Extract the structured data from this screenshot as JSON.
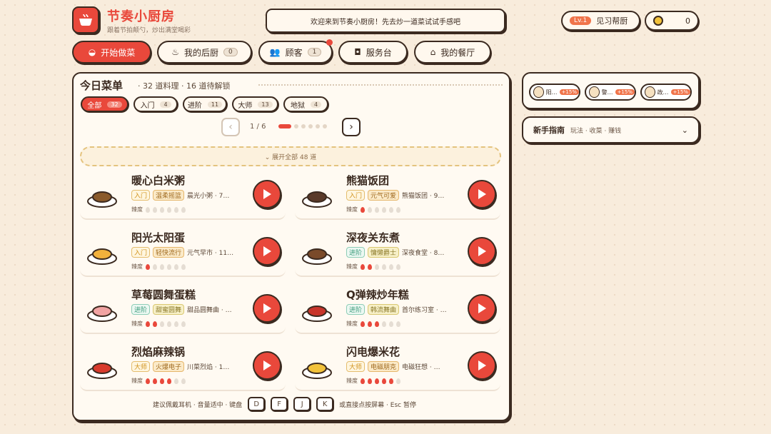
{
  "app": {
    "title": "节奏小厨房",
    "subtitle": "跟着节拍颠勺，炒出满堂喝彩",
    "welcome": "欢迎来到节奏小厨房！先去炒一道菜试试手感吧"
  },
  "player": {
    "level": "Lv.1",
    "rank": "见习帮厨",
    "coins": "0"
  },
  "nav": {
    "start": "开始做菜",
    "kitchen": "我的后厨",
    "kitchen_count": "0",
    "customers": "顾客",
    "customers_count": "1",
    "counter": "服务台",
    "restaurant": "我的餐厅"
  },
  "menu": {
    "title": "今日菜单",
    "summary": "· 32 道料理 · 16 道待解锁",
    "page": "1 / 6",
    "expand": "⌄ 展开全部 48 道",
    "filters": [
      {
        "label": "全部",
        "count": "32"
      },
      {
        "label": "入门",
        "count": "4"
      },
      {
        "label": "进阶",
        "count": "11"
      },
      {
        "label": "大师",
        "count": "13"
      },
      {
        "label": "地狱",
        "count": "4"
      }
    ],
    "spice_label": "辣度",
    "dishes": [
      {
        "name": "暖心白米粥",
        "level": "入门",
        "genre": "温柔摇篮",
        "song": "晨光小粥 · 7…",
        "spice": 0
      },
      {
        "name": "熊猫饭团",
        "level": "入门",
        "genre": "元气可爱",
        "song": "熊猫饭团 · 9…",
        "spice": 1
      },
      {
        "name": "阳光太阳蛋",
        "level": "入门",
        "genre": "轻快流行",
        "song": "元气早市 · 11…",
        "spice": 1
      },
      {
        "name": "深夜关东煮",
        "level": "进阶",
        "genre": "慵懒爵士",
        "song": "深夜食堂 · 8…",
        "spice": 2
      },
      {
        "name": "草莓圆舞蛋糕",
        "level": "进阶",
        "genre": "甜蜜圆舞",
        "song": "甜品圆舞曲 · …",
        "spice": 2
      },
      {
        "name": "Q弹辣炒年糕",
        "level": "进阶",
        "genre": "韩流舞曲",
        "song": "首尔练习室 · …",
        "spice": 3
      },
      {
        "name": "烈焰麻辣锅",
        "level": "大师",
        "genre": "火爆电子",
        "song": "川菜烈焰 · 1…",
        "spice": 4
      },
      {
        "name": "闪电爆米花",
        "level": "大师",
        "genre": "电磁朋克",
        "song": "电磁狂想 · …",
        "spice": 5
      }
    ]
  },
  "footer": {
    "hint": "建议佩戴耳机 · 音量适中 · 键盘",
    "keys": [
      "D",
      "F",
      "J",
      "K"
    ],
    "tail": "或直接点按屏幕 · Esc 暂停"
  },
  "guests": [
    {
      "name": "阳…",
      "bonus": "+15%"
    },
    {
      "name": "警…",
      "bonus": "+15%"
    },
    {
      "name": "政…",
      "bonus": "+15%"
    }
  ],
  "guide": {
    "title": "新手指南",
    "sub": "玩法 · 收菜 · 赚钱"
  }
}
